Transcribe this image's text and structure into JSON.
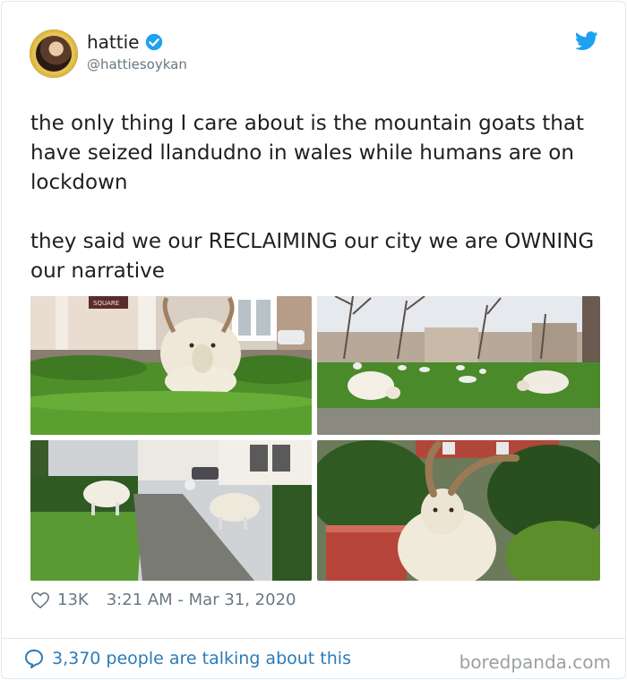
{
  "user": {
    "display_name": "hattie",
    "handle": "@hattiesoykan"
  },
  "tweet": {
    "text_paragraph_1": "the only thing I care about is the mountain goats that have seized llandudno in wales while humans are on lockdown",
    "text_paragraph_2": "they said we our RECLAIMING our city we are OWNING our narrative"
  },
  "media": {
    "photo_1_sign": "SQUARE"
  },
  "meta": {
    "likes": "13K",
    "timestamp": "3:21 AM - Mar 31, 2020"
  },
  "footer": {
    "talking": "3,370 people are talking about this",
    "watermark": "boredpanda.com"
  },
  "colors": {
    "link_blue": "#2b7bb9",
    "twitter_blue": "#1da1f2",
    "muted_gray": "#697882",
    "text_dark": "#1c2022"
  },
  "icons": [
    "verified-icon",
    "twitter-logo-icon",
    "heart-icon",
    "speech-bubble-icon"
  ]
}
